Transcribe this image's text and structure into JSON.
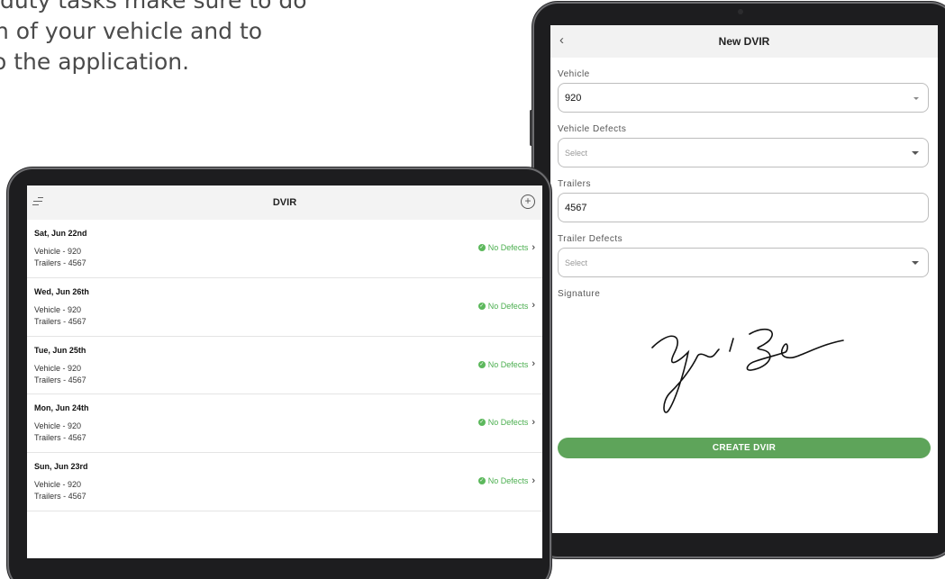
{
  "intro": {
    "line1": "duty tasks make sure to do",
    "line2": "n of your vehicle and to",
    "line3": "o the application."
  },
  "list_screen": {
    "title": "DVIR",
    "menu_icon": "menu-icon",
    "add_icon": "plus-circle-icon",
    "items": [
      {
        "date": "Sat, Jun 22nd",
        "vehicle": "Vehicle - 920",
        "trailers": "Trailers - 4567",
        "status": "No Defects"
      },
      {
        "date": "Wed, Jun 26th",
        "vehicle": "Vehicle - 920",
        "trailers": "Trailers - 4567",
        "status": "No Defects"
      },
      {
        "date": "Tue, Jun 25th",
        "vehicle": "Vehicle - 920",
        "trailers": "Trailers - 4567",
        "status": "No Defects"
      },
      {
        "date": "Mon, Jun 24th",
        "vehicle": "Vehicle - 920",
        "trailers": "Trailers - 4567",
        "status": "No Defects"
      },
      {
        "date": "Sun, Jun 23rd",
        "vehicle": "Vehicle - 920",
        "trailers": "Trailers - 4567",
        "status": "No Defects"
      }
    ],
    "status_color": "#4caf50"
  },
  "form_screen": {
    "title": "New DVIR",
    "vehicle_label": "Vehicle",
    "vehicle_value": "920",
    "vehicle_defects_label": "Vehicle Defects",
    "vehicle_defects_placeholder": "Select",
    "trailers_label": "Trailers",
    "trailers_value": "4567",
    "trailer_defects_label": "Trailer Defects",
    "trailer_defects_placeholder": "Select",
    "signature_label": "Signature",
    "create_button": "CREATE DVIR",
    "accent_color": "#5ea45a"
  }
}
